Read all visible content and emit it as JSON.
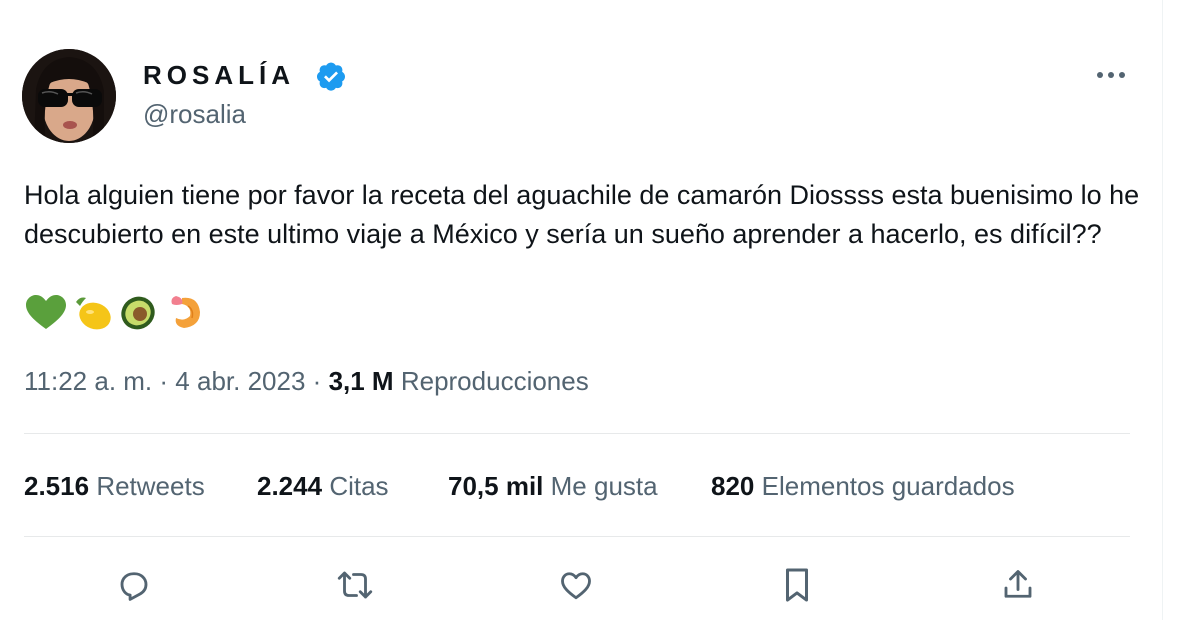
{
  "author": {
    "display_name": "ROSALÍA",
    "handle": "@rosalia",
    "verified_color": "#1d9bf0"
  },
  "tweet": {
    "text": "Hola alguien tiene por favor la receta del aguachile de camarón Diossss esta buenisimo lo he descubierto en este ultimo viaje a México y sería un sueño aprender a hacerlo, es difícil??",
    "emojis": [
      "green-heart",
      "lemon",
      "avocado",
      "shrimp"
    ]
  },
  "meta": {
    "time": "11:22 a. m.",
    "separator": "·",
    "date": "4 abr. 2023",
    "views_count": "3,1 M",
    "views_label": "Reproducciones"
  },
  "stats": {
    "retweets_count": "2.516",
    "retweets_label": "Retweets",
    "quotes_count": "2.244",
    "quotes_label": "Citas",
    "likes_count": "70,5 mil",
    "likes_label": "Me gusta",
    "bookmarks_count": "820",
    "bookmarks_label": "Elementos guardados"
  },
  "actions": [
    "reply-icon",
    "retweet-icon",
    "like-icon",
    "bookmark-icon",
    "share-icon"
  ],
  "colors": {
    "text_primary": "#0f1419",
    "text_secondary": "#536471",
    "divider": "#e7e9ea",
    "accent": "#1d9bf0"
  }
}
